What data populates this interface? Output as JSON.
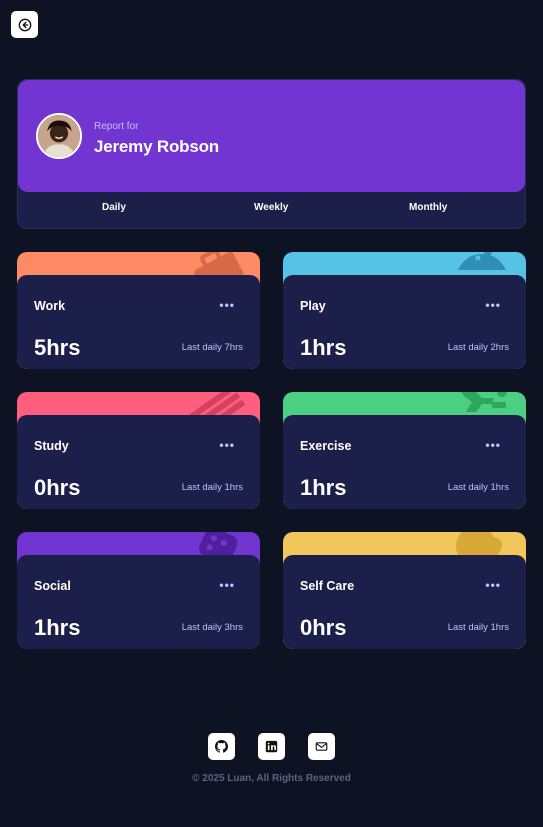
{
  "header": {
    "back_icon": "back-arrow-circle-icon"
  },
  "profile": {
    "report_label": "Report for",
    "name": "Jeremy Robson",
    "avatar_icon": "user-avatar",
    "tabs": [
      {
        "label": "Daily"
      },
      {
        "label": "Weekly"
      },
      {
        "label": "Monthly"
      }
    ],
    "active_tab": "Daily",
    "accent_color": "#7235d1",
    "card_color": "#1c1f4a"
  },
  "activities": [
    {
      "title": "Work",
      "hours": "5hrs",
      "last": "Last daily 7hrs",
      "color": "#ff8b64",
      "icon": "briefcase-icon"
    },
    {
      "title": "Play",
      "hours": "1hrs",
      "last": "Last daily 2hrs",
      "color": "#55c2e6",
      "icon": "gamepad-icon"
    },
    {
      "title": "Study",
      "hours": "0hrs",
      "last": "Last daily 1hrs",
      "color": "#ff5e7d",
      "icon": "books-icon"
    },
    {
      "title": "Exercise",
      "hours": "1hrs",
      "last": "Last daily 1hrs",
      "color": "#4bcf82",
      "icon": "runner-icon"
    },
    {
      "title": "Social",
      "hours": "1hrs",
      "last": "Last daily 3hrs",
      "color": "#7335d2",
      "icon": "chat-bubble-icon"
    },
    {
      "title": "Self Care",
      "hours": "0hrs",
      "last": "Last daily 1hrs",
      "color": "#f1c75b",
      "icon": "heart-face-icon"
    }
  ],
  "menu_dots": "•••",
  "footer": {
    "icons": [
      "github-icon",
      "linkedin-icon",
      "mail-icon"
    ],
    "copyright": "© 2025 Luan, All Rights Reserved"
  }
}
